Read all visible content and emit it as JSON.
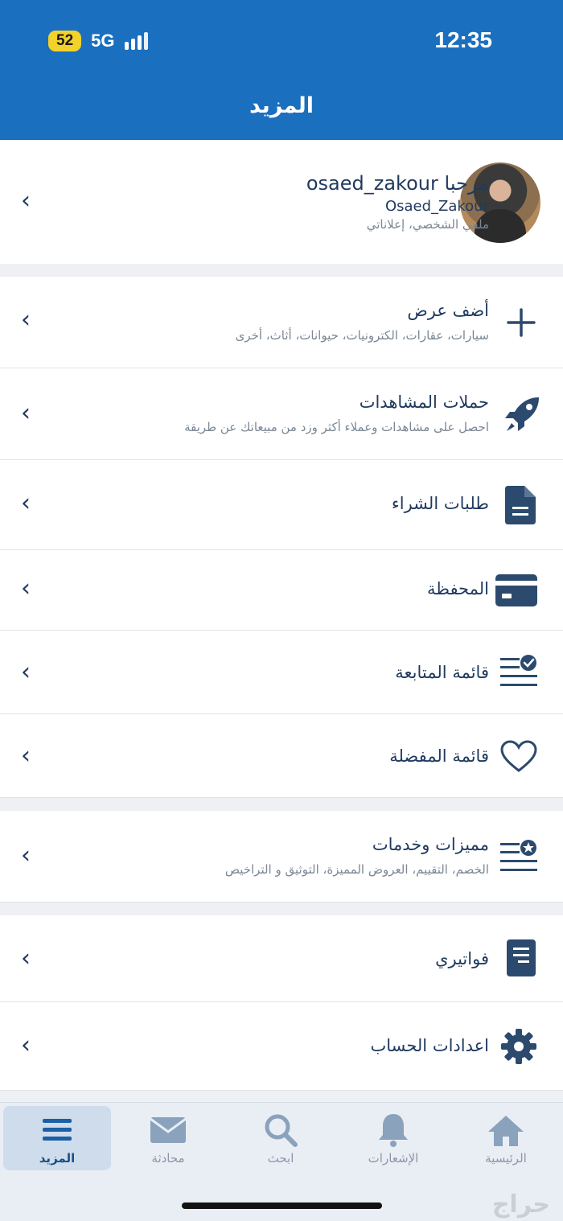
{
  "status_bar": {
    "time": "12:35",
    "battery": "52",
    "network": "5G"
  },
  "header": {
    "title": "المزيد"
  },
  "profile": {
    "greeting": "مرحبا osaed_zakour",
    "username": "Osaed_Zakour",
    "subtitle": "ملفي الشخصي، إعلاناتي"
  },
  "menu": {
    "add_offer": {
      "title": "أضف عرض",
      "subtitle": "سيارات، عقارات، الكترونيات، حيوانات، أثاث، أخرى",
      "icon": "plus-icon"
    },
    "view_campaigns": {
      "title": "حملات المشاهدات",
      "subtitle": "احصل على مشاهدات وعملاء أكثر وزد من مبيعاتك عن طريقة",
      "icon": "rocket-icon"
    },
    "purchase_requests": {
      "title": "طلبات الشراء",
      "icon": "document-icon"
    },
    "wallet": {
      "title": "المحفظة",
      "icon": "card-icon"
    },
    "following": {
      "title": "قائمة المتابعة",
      "icon": "checklist-icon"
    },
    "favorites": {
      "title": "قائمة المفضلة",
      "icon": "heart-icon"
    },
    "features": {
      "title": "مميزات وخدمات",
      "subtitle": "الخصم، التقييم، العروض المميزة، التوثيق و التراخيص",
      "icon": "star-list-icon"
    },
    "invoices": {
      "title": "فواتيري",
      "icon": "invoice-icon"
    },
    "settings": {
      "title": "اعدادات الحساب",
      "icon": "gear-icon"
    }
  },
  "bottom_nav": {
    "home": "الرئيسية",
    "notifications": "الإشعارات",
    "search": "ابحث",
    "chat": "محادثة",
    "more": "المزيد"
  },
  "watermark": "حراج",
  "colors": {
    "header_bg": "#1b6fbf",
    "icon": "#2c4a6e",
    "active_tab_bg": "#cfdceb",
    "battery": "#f3d22a"
  }
}
